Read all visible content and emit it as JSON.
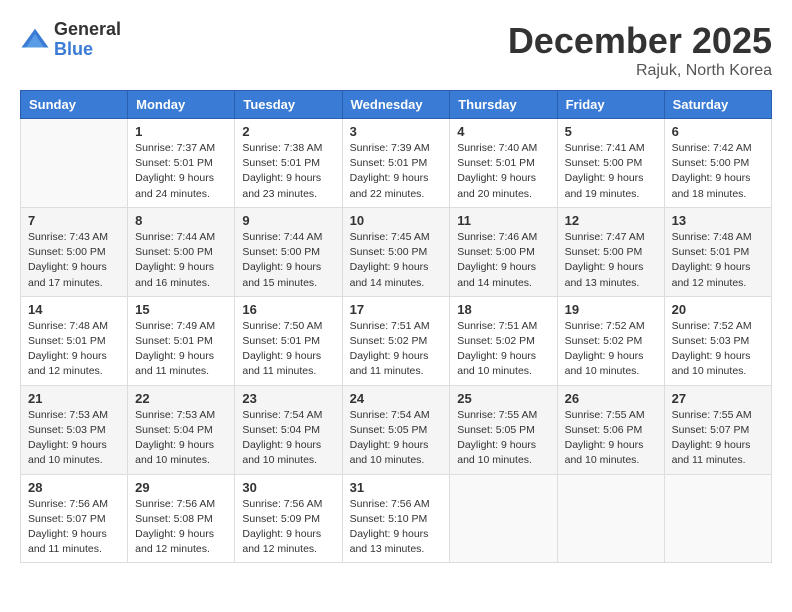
{
  "logo": {
    "general": "General",
    "blue": "Blue"
  },
  "title": "December 2025",
  "location": "Rajuk, North Korea",
  "days_header": [
    "Sunday",
    "Monday",
    "Tuesday",
    "Wednesday",
    "Thursday",
    "Friday",
    "Saturday"
  ],
  "weeks": [
    [
      {
        "day": "",
        "sunrise": "",
        "sunset": "",
        "daylight": ""
      },
      {
        "day": "1",
        "sunrise": "Sunrise: 7:37 AM",
        "sunset": "Sunset: 5:01 PM",
        "daylight": "Daylight: 9 hours and 24 minutes."
      },
      {
        "day": "2",
        "sunrise": "Sunrise: 7:38 AM",
        "sunset": "Sunset: 5:01 PM",
        "daylight": "Daylight: 9 hours and 23 minutes."
      },
      {
        "day": "3",
        "sunrise": "Sunrise: 7:39 AM",
        "sunset": "Sunset: 5:01 PM",
        "daylight": "Daylight: 9 hours and 22 minutes."
      },
      {
        "day": "4",
        "sunrise": "Sunrise: 7:40 AM",
        "sunset": "Sunset: 5:01 PM",
        "daylight": "Daylight: 9 hours and 20 minutes."
      },
      {
        "day": "5",
        "sunrise": "Sunrise: 7:41 AM",
        "sunset": "Sunset: 5:00 PM",
        "daylight": "Daylight: 9 hours and 19 minutes."
      },
      {
        "day": "6",
        "sunrise": "Sunrise: 7:42 AM",
        "sunset": "Sunset: 5:00 PM",
        "daylight": "Daylight: 9 hours and 18 minutes."
      }
    ],
    [
      {
        "day": "7",
        "sunrise": "Sunrise: 7:43 AM",
        "sunset": "Sunset: 5:00 PM",
        "daylight": "Daylight: 9 hours and 17 minutes."
      },
      {
        "day": "8",
        "sunrise": "Sunrise: 7:44 AM",
        "sunset": "Sunset: 5:00 PM",
        "daylight": "Daylight: 9 hours and 16 minutes."
      },
      {
        "day": "9",
        "sunrise": "Sunrise: 7:44 AM",
        "sunset": "Sunset: 5:00 PM",
        "daylight": "Daylight: 9 hours and 15 minutes."
      },
      {
        "day": "10",
        "sunrise": "Sunrise: 7:45 AM",
        "sunset": "Sunset: 5:00 PM",
        "daylight": "Daylight: 9 hours and 14 minutes."
      },
      {
        "day": "11",
        "sunrise": "Sunrise: 7:46 AM",
        "sunset": "Sunset: 5:00 PM",
        "daylight": "Daylight: 9 hours and 14 minutes."
      },
      {
        "day": "12",
        "sunrise": "Sunrise: 7:47 AM",
        "sunset": "Sunset: 5:00 PM",
        "daylight": "Daylight: 9 hours and 13 minutes."
      },
      {
        "day": "13",
        "sunrise": "Sunrise: 7:48 AM",
        "sunset": "Sunset: 5:01 PM",
        "daylight": "Daylight: 9 hours and 12 minutes."
      }
    ],
    [
      {
        "day": "14",
        "sunrise": "Sunrise: 7:48 AM",
        "sunset": "Sunset: 5:01 PM",
        "daylight": "Daylight: 9 hours and 12 minutes."
      },
      {
        "day": "15",
        "sunrise": "Sunrise: 7:49 AM",
        "sunset": "Sunset: 5:01 PM",
        "daylight": "Daylight: 9 hours and 11 minutes."
      },
      {
        "day": "16",
        "sunrise": "Sunrise: 7:50 AM",
        "sunset": "Sunset: 5:01 PM",
        "daylight": "Daylight: 9 hours and 11 minutes."
      },
      {
        "day": "17",
        "sunrise": "Sunrise: 7:51 AM",
        "sunset": "Sunset: 5:02 PM",
        "daylight": "Daylight: 9 hours and 11 minutes."
      },
      {
        "day": "18",
        "sunrise": "Sunrise: 7:51 AM",
        "sunset": "Sunset: 5:02 PM",
        "daylight": "Daylight: 9 hours and 10 minutes."
      },
      {
        "day": "19",
        "sunrise": "Sunrise: 7:52 AM",
        "sunset": "Sunset: 5:02 PM",
        "daylight": "Daylight: 9 hours and 10 minutes."
      },
      {
        "day": "20",
        "sunrise": "Sunrise: 7:52 AM",
        "sunset": "Sunset: 5:03 PM",
        "daylight": "Daylight: 9 hours and 10 minutes."
      }
    ],
    [
      {
        "day": "21",
        "sunrise": "Sunrise: 7:53 AM",
        "sunset": "Sunset: 5:03 PM",
        "daylight": "Daylight: 9 hours and 10 minutes."
      },
      {
        "day": "22",
        "sunrise": "Sunrise: 7:53 AM",
        "sunset": "Sunset: 5:04 PM",
        "daylight": "Daylight: 9 hours and 10 minutes."
      },
      {
        "day": "23",
        "sunrise": "Sunrise: 7:54 AM",
        "sunset": "Sunset: 5:04 PM",
        "daylight": "Daylight: 9 hours and 10 minutes."
      },
      {
        "day": "24",
        "sunrise": "Sunrise: 7:54 AM",
        "sunset": "Sunset: 5:05 PM",
        "daylight": "Daylight: 9 hours and 10 minutes."
      },
      {
        "day": "25",
        "sunrise": "Sunrise: 7:55 AM",
        "sunset": "Sunset: 5:05 PM",
        "daylight": "Daylight: 9 hours and 10 minutes."
      },
      {
        "day": "26",
        "sunrise": "Sunrise: 7:55 AM",
        "sunset": "Sunset: 5:06 PM",
        "daylight": "Daylight: 9 hours and 10 minutes."
      },
      {
        "day": "27",
        "sunrise": "Sunrise: 7:55 AM",
        "sunset": "Sunset: 5:07 PM",
        "daylight": "Daylight: 9 hours and 11 minutes."
      }
    ],
    [
      {
        "day": "28",
        "sunrise": "Sunrise: 7:56 AM",
        "sunset": "Sunset: 5:07 PM",
        "daylight": "Daylight: 9 hours and 11 minutes."
      },
      {
        "day": "29",
        "sunrise": "Sunrise: 7:56 AM",
        "sunset": "Sunset: 5:08 PM",
        "daylight": "Daylight: 9 hours and 12 minutes."
      },
      {
        "day": "30",
        "sunrise": "Sunrise: 7:56 AM",
        "sunset": "Sunset: 5:09 PM",
        "daylight": "Daylight: 9 hours and 12 minutes."
      },
      {
        "day": "31",
        "sunrise": "Sunrise: 7:56 AM",
        "sunset": "Sunset: 5:10 PM",
        "daylight": "Daylight: 9 hours and 13 minutes."
      },
      {
        "day": "",
        "sunrise": "",
        "sunset": "",
        "daylight": ""
      },
      {
        "day": "",
        "sunrise": "",
        "sunset": "",
        "daylight": ""
      },
      {
        "day": "",
        "sunrise": "",
        "sunset": "",
        "daylight": ""
      }
    ]
  ]
}
